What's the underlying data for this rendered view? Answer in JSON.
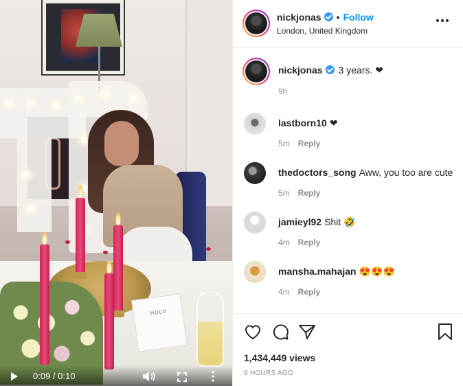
{
  "video": {
    "card_text": "HOLD",
    "time": "0:09 / 0:10"
  },
  "header": {
    "username": "nickjonas",
    "separator": "•",
    "follow_label": "Follow",
    "location": "London, United Kingdom"
  },
  "caption": {
    "username": "nickjonas",
    "text": "3 years. ❤",
    "time": "9h"
  },
  "comments": [
    {
      "username": "lastborn10",
      "text": "❤",
      "time": "5m",
      "reply_label": "Reply"
    },
    {
      "username": "thedoctors_song",
      "text": "Aww, you too are cute",
      "time": "5m",
      "reply_label": "Reply"
    },
    {
      "username": "jamieyl92",
      "text": "Shit 🤣",
      "time": "4m",
      "reply_label": "Reply"
    },
    {
      "username": "mansha.mahajan",
      "text": "😍😍😍",
      "time": "4m",
      "reply_label": "Reply"
    }
  ],
  "footer": {
    "views": "1,434,449 views",
    "posted": "9 HOURS AGO"
  },
  "icons": {
    "like": "heart-icon",
    "comment": "comment-icon",
    "share": "share-icon",
    "save": "bookmark-icon"
  },
  "colors": {
    "accent": "#0095f6",
    "verified": "#3897f0",
    "muted": "#8e8e8e",
    "text": "#262626"
  }
}
